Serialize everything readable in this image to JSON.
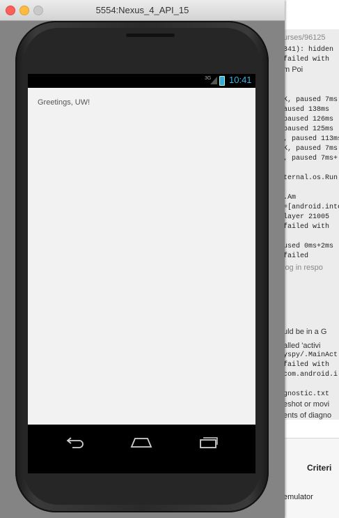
{
  "window": {
    "title": "5554:Nexus_4_API_15"
  },
  "status_bar": {
    "network": "3G",
    "time": "10:41"
  },
  "app": {
    "greeting": "Greetings, UW!"
  },
  "nav": {
    "back": "back-icon",
    "home": "home-icon",
    "recent": "recent-apps-icon"
  },
  "background_window": {
    "lines": [
      "urses/96125",
      "341): hidden",
      " failed with",
      "m       Poi",
      "K, paused 7ms",
      "aused 138ms",
      " paused 126ms",
      "paused 125ms",
      ", paused 113ms",
      "K, paused 7ms",
      ", paused 7ms+",
      "ternal.os.Run",
      ".Am",
      "=[android.inte",
      "layer 21005",
      " failed with",
      "used 0ms+2ms",
      "failed",
      "log in respo",
      "uld be in a G",
      "alled 'activi",
      "yspy/.MainAct",
      " failed with",
      "com.android.i",
      "gnostic.txt",
      "eshot or movi",
      "ents of diagno"
    ],
    "criteria_header": "Criteri",
    "row_text": "emulator"
  },
  "colors": {
    "status_time": "#33b5e5",
    "screen_bg": "#f2f2f2"
  }
}
